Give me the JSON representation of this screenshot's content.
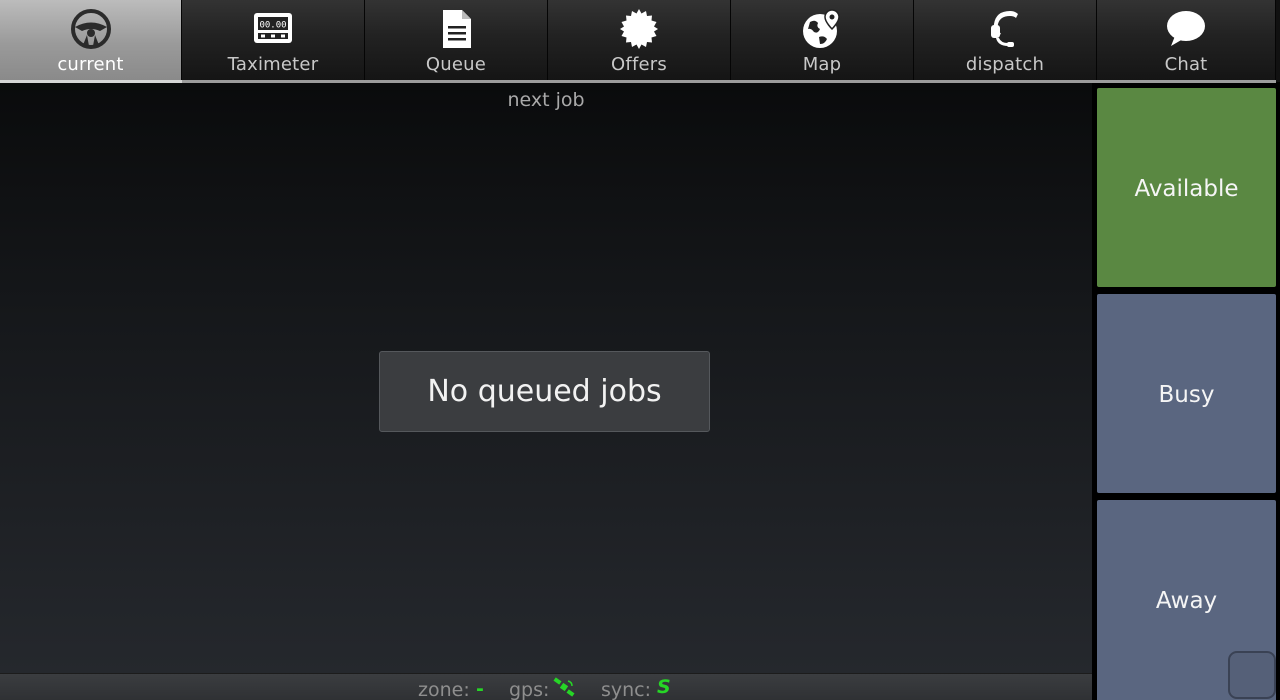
{
  "tabs": [
    {
      "label": "current",
      "icon": "steering-wheel-icon",
      "active": true
    },
    {
      "label": "Taximeter",
      "icon": "taximeter-icon",
      "active": false,
      "display": "00.00"
    },
    {
      "label": "Queue",
      "icon": "document-icon",
      "active": false
    },
    {
      "label": "Offers",
      "icon": "seal-badge-icon",
      "active": false
    },
    {
      "label": "Map",
      "icon": "globe-pin-icon",
      "active": false
    },
    {
      "label": "dispatch",
      "icon": "headset-icon",
      "active": false
    },
    {
      "label": "Chat",
      "icon": "speech-bubble-icon",
      "active": false
    }
  ],
  "main": {
    "section_title": "next job",
    "empty_message": "No queued jobs"
  },
  "status_bar": {
    "zone_label": "zone:",
    "zone_value": "-",
    "gps_label": "gps:",
    "gps_icon": "satellite-icon",
    "sync_label": "sync:",
    "sync_value": "S"
  },
  "states": {
    "available": "Available",
    "busy": "Busy",
    "away": "Away"
  },
  "colors": {
    "available": "#5a8842",
    "busy": "#5a6680",
    "away": "#5a6680",
    "status_ok": "#26d626"
  }
}
